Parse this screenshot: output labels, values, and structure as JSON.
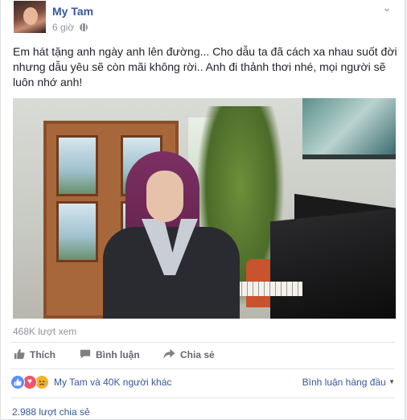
{
  "post": {
    "author": "My Tam",
    "time": "6 giờ",
    "text": "Em hát tặng anh ngày anh lên đường... Cho dẫu ta đã cách xa nhau suốt đời nhưng dẫu yêu sẽ còn mãi không rời.. Anh đi thảnh thơi nhé, mọi người sẽ luôn nhớ anh!",
    "views": "468K lượt xem"
  },
  "actions": {
    "like": "Thích",
    "comment": "Bình luận",
    "share": "Chia sẻ"
  },
  "reactions": {
    "summary": "My Tam và 40K người khác",
    "sort_label": "Bình luận hàng đầu",
    "shares": "2.988 lượt chia sẻ",
    "icons": [
      "like-icon",
      "love-icon",
      "sad-icon"
    ]
  },
  "colors": {
    "link": "#365899",
    "muted": "#90949c",
    "action": "#616770",
    "like": "#5890ff",
    "love": "#f25268",
    "sad": "#f7b125"
  }
}
